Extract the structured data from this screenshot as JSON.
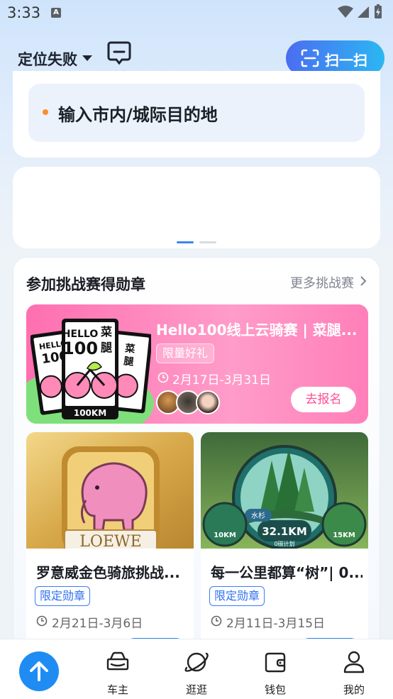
{
  "status_bar": {
    "time": "3:33",
    "notification_letter": "A"
  },
  "header": {
    "location": "定位失败",
    "message_label": "消息",
    "scan_label": "扫一扫"
  },
  "search": {
    "placeholder": "输入市内/城际目的地"
  },
  "challenge": {
    "title": "参加挑战赛得勋章",
    "more_label": "更多挑战赛",
    "featured": {
      "title": "Hello100线上云骑赛 | 菜腿...",
      "tag": "限量好礼",
      "date": "2月17日-3月31日",
      "button": "去报名",
      "art_text": [
        "HELLO",
        "100",
        "菜",
        "腿",
        "100KM"
      ]
    },
    "cards": [
      {
        "title": "罗意威金色骑旅挑战...",
        "tag": "限定勋章",
        "date": "2月21日-3月6日",
        "art_text": "LOEWE"
      },
      {
        "title": "每一公里都算“树”| 0...",
        "tag": "限定勋章",
        "date": "2月11日-3月15日",
        "art_text": [
          "水杉",
          "32.1KM",
          "0碳计划",
          "10KM",
          "15KM"
        ]
      }
    ]
  },
  "bottom_nav": {
    "items": [
      {
        "label": "车主",
        "icon": "car-icon"
      },
      {
        "label": "逛逛",
        "icon": "planet-icon"
      },
      {
        "label": "钱包",
        "icon": "wallet-icon"
      },
      {
        "label": "我的",
        "icon": "person-icon"
      }
    ]
  },
  "colors": {
    "accent": "#1f8cf3",
    "featured_pink": "#ff6fb0",
    "tag_blue": "#2c6ff0",
    "search_dot": "#ff8c2a"
  }
}
